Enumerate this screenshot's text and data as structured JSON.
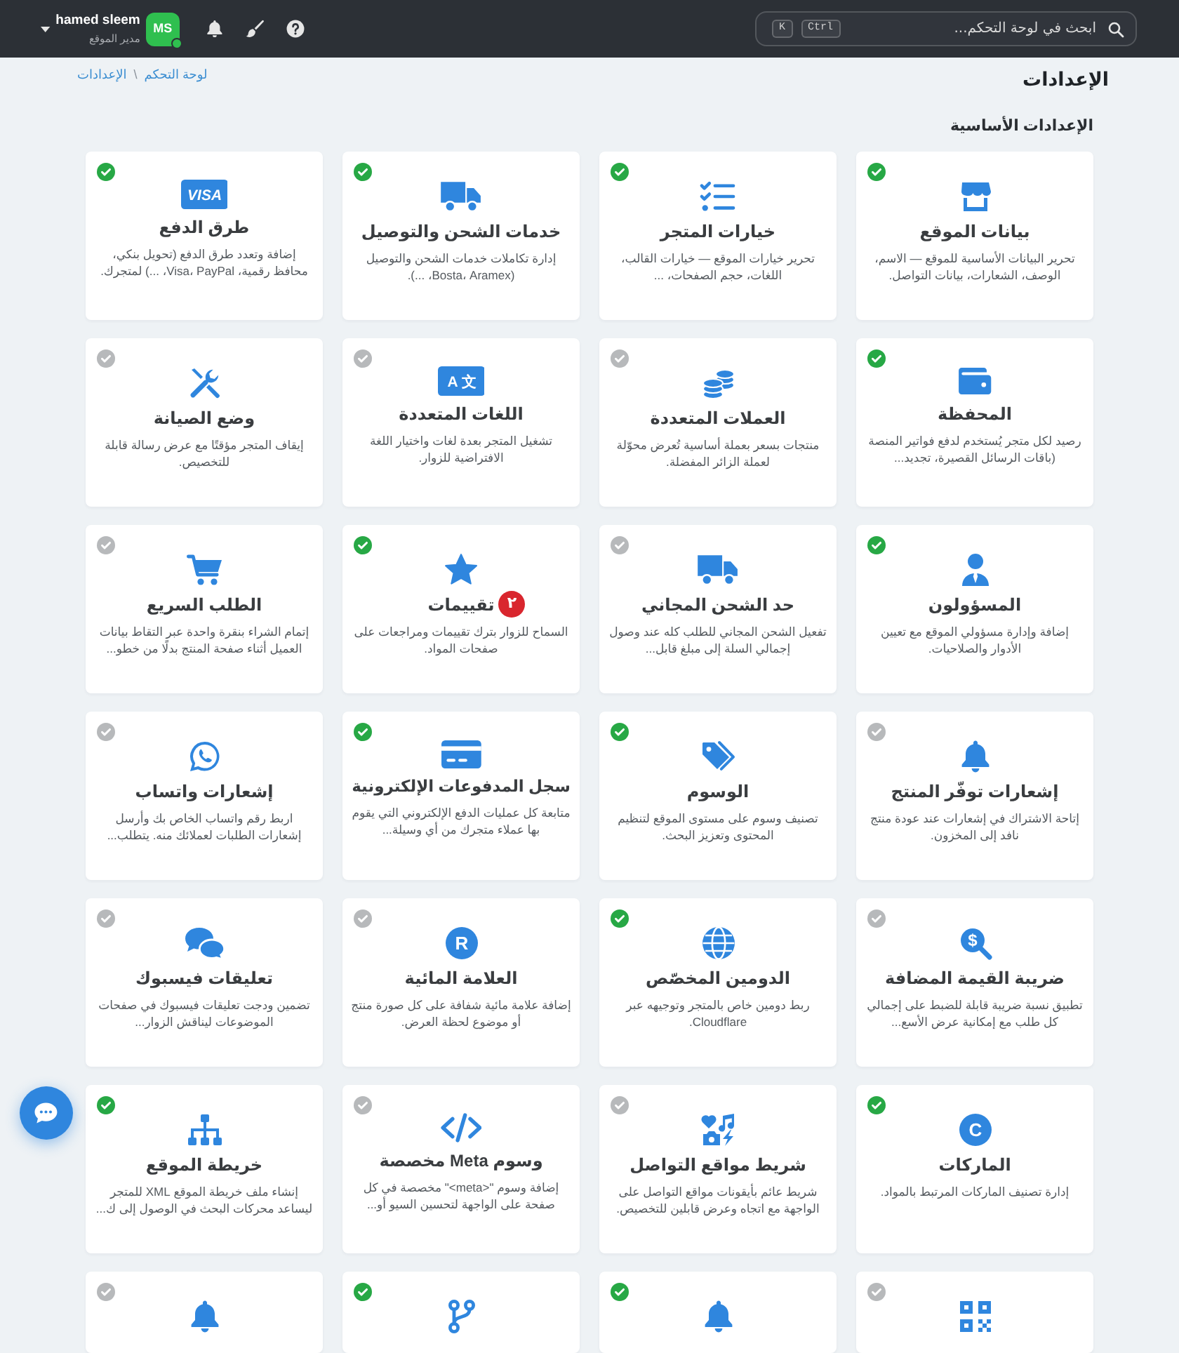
{
  "topbar": {
    "search": {
      "placeholder": "ابحث في لوحة التحكم...",
      "keys": [
        "Ctrl",
        "K"
      ]
    },
    "user": {
      "initials": "MS",
      "name": "hamed sleem",
      "role": "مدير الموقع",
      "online": true
    }
  },
  "page": {
    "title": "الإعدادات",
    "breadcrumb": [
      "لوحة التحكم",
      "الإعدادات"
    ],
    "breadcrumb_separator": "\\"
  },
  "section": {
    "title": "الإعدادات الأساسية",
    "cards": [
      {
        "kind": "store",
        "enabled": true,
        "title": "بيانات الموقع",
        "description": "تحرير البيانات الأساسية للموقع — الاسم، الوصف، الشعارات، بيانات التواصل."
      },
      {
        "kind": "checklist",
        "enabled": true,
        "title": "خيارات المتجر",
        "description": "تحرير خيارات الموقع — خيارات القالب، اللغات، حجم الصفحات، ..."
      },
      {
        "kind": "truck",
        "enabled": true,
        "title": "خدمات الشحن والتوصيل",
        "description": "إدارة تكاملات خدمات الشحن والتوصيل (Bosta، Aramex، ...)."
      },
      {
        "kind": "visa",
        "enabled": true,
        "icon_text": "VISA",
        "title": "طرق الدفع",
        "description": "إضافة وتعدد طرق الدفع (تحويل بنكي، محافظ رقمية، Visa، PayPal، ...) لمتجرك."
      },
      {
        "kind": "wallet",
        "enabled": true,
        "title": "المحفظة",
        "description": "رصيد لكل متجر يُستخدم لدفع فواتير المنصة (باقات الرسائل القصيرة، تجديد..."
      },
      {
        "kind": "coins",
        "enabled": false,
        "title": "العملات المتعددة",
        "description": "منتجات بسعر بعملة أساسية تُعرض محوّلة لعملة الزائر المفضلة."
      },
      {
        "kind": "language",
        "enabled": false,
        "icon_text": "A 文",
        "title": "اللغات المتعددة",
        "description": "تشغيل المتجر بعدة لغات واختيار اللغة الافتراضية للزوار."
      },
      {
        "kind": "tools",
        "enabled": false,
        "title": "وضع الصيانة",
        "description": "إيقاف المتجر مؤقتًا مع عرض رسالة قابلة للتخصيص."
      },
      {
        "kind": "user",
        "enabled": true,
        "title": "المسؤولون",
        "description": "إضافة وإدارة مسؤولي الموقع مع تعيين الأدوار والصلاحيات."
      },
      {
        "kind": "truck",
        "enabled": false,
        "title": "حد الشحن المجاني",
        "description": "تفعيل الشحن المجاني للطلب كله عند وصول إجمالي السلة إلى مبلغ قابل..."
      },
      {
        "kind": "star",
        "enabled": true,
        "title": "تقييمات",
        "badge": "٢",
        "description": "السماح للزوار بترك تقييمات ومراجعات على صفحات المواد."
      },
      {
        "kind": "cart",
        "enabled": false,
        "title": "الطلب السريع",
        "description": "إتمام الشراء بنقرة واحدة عبر التقاط بيانات العميل أثناء صفحة المنتج بدلًا من خطو..."
      },
      {
        "kind": "bell",
        "enabled": false,
        "title": "إشعارات توفّر المنتج",
        "description": "إتاحة الاشتراك في إشعارات عند عودة منتج نافد إلى المخزون."
      },
      {
        "kind": "tags",
        "enabled": true,
        "title": "الوسوم",
        "description": "تصنيف وسوم على مستوى الموقع لتنظيم المحتوى وتعزيز البحث."
      },
      {
        "kind": "card",
        "enabled": true,
        "title": "سجل المدفوعات الإلكترونية",
        "description": "متابعة كل عمليات الدفع الإلكتروني التي يقوم بها عملاء متجرك من أي وسيلة..."
      },
      {
        "kind": "whatsapp",
        "enabled": false,
        "title": "إشعارات واتساب",
        "description": "اربط رقم واتساب الخاص بك وأرسل إشعارات الطلبات لعملائك منه. يتطلب..."
      },
      {
        "kind": "tax",
        "enabled": false,
        "icon_text": "$",
        "title": "ضريبة القيمة المضافة",
        "description": "تطبيق نسبة ضريبة قابلة للضبط على إجمالي كل طلب مع إمكانية عرض الأسع..."
      },
      {
        "kind": "globe",
        "enabled": true,
        "title": "الدومين المخصّص",
        "description": "ربط دومين خاص بالمتجر وتوجيهه عبر Cloudflare."
      },
      {
        "kind": "letter",
        "enabled": false,
        "icon_text": "R",
        "title": "العلامة المائية",
        "description": "إضافة علامة مائية شفافة على كل صورة منتج أو موضوع لحظة العرض."
      },
      {
        "kind": "comments",
        "enabled": false,
        "title": "تعليقات فيسبوك",
        "description": "تضمين ودجت تعليقات فيسبوك في صفحات الموضوعات ليناقش الزوار..."
      },
      {
        "kind": "letter",
        "enabled": true,
        "icon_text": "C",
        "title": "الماركات",
        "description": "إدارة تصنيف الماركات المرتبط بالمواد."
      },
      {
        "kind": "social",
        "enabled": false,
        "title": "شريط مواقع التواصل",
        "description": "شريط عائم بأيقونات مواقع التواصل على الواجهة مع اتجاه وعرض قابلين للتخصيص."
      },
      {
        "kind": "code",
        "enabled": false,
        "title": "وسوم Meta مخصصة",
        "description": "إضافة وسوم \"<meta>\" مخصصة في كل صفحة على الواجهة لتحسين السيو أو..."
      },
      {
        "kind": "sitemap",
        "enabled": true,
        "title": "خريطة الموقع",
        "description": "إنشاء ملف خريطة الموقع XML للمتجر ليساعد محركات البحث في الوصول إلى ك..."
      },
      {
        "kind": "qr",
        "enabled": false
      },
      {
        "kind": "bell",
        "enabled": true
      },
      {
        "kind": "branch",
        "enabled": true
      },
      {
        "kind": "bell",
        "enabled": false
      }
    ]
  }
}
